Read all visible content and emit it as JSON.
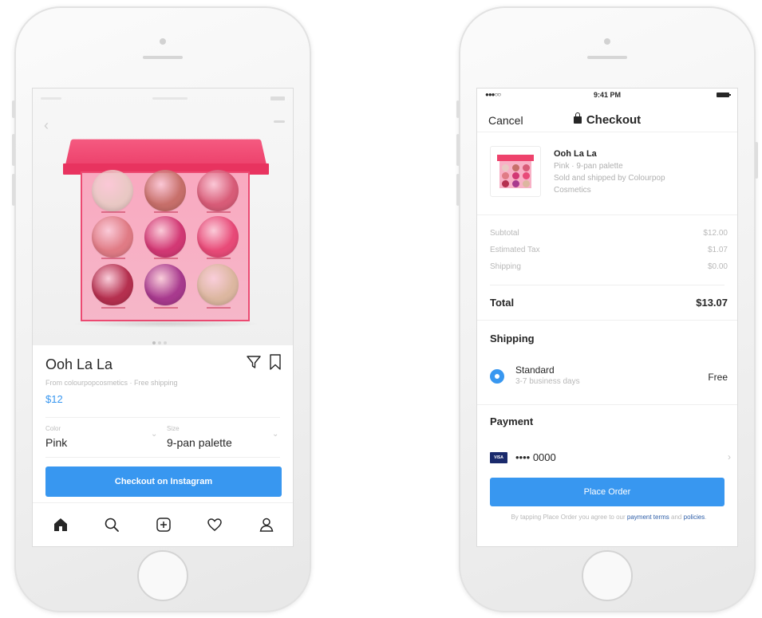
{
  "left_phone": {
    "product_name": "Ooh La La",
    "merchant_line": "From colourpopcosmetics · Free shipping",
    "price": "$12",
    "color_label": "Color",
    "color_value": "Pink",
    "size_label": "Size",
    "size_value": "9-pan palette",
    "checkout_button": "Checkout on Instagram",
    "icons": [
      "back-chevron",
      "more-dots",
      "filter-icon",
      "bookmark-icon",
      "home-icon",
      "search-icon",
      "add-icon",
      "heart-icon",
      "profile-icon"
    ],
    "palette_shade_colors": [
      "#e9c8c4",
      "#c76f6a",
      "#d85c78",
      "#e07b85",
      "#d23874",
      "#e84a78",
      "#b5304f",
      "#a83a8e",
      "#dcb7a0"
    ],
    "accent_color": "#3897f0"
  },
  "right_phone": {
    "status_time": "9:41 PM",
    "signal_text": "●●●○○",
    "cancel_label": "Cancel",
    "title": "Checkout",
    "item_title": "Ooh La La",
    "item_variant": "Pink · 9-pan palette",
    "item_seller_1": "Sold and shipped by Colourpop",
    "item_seller_2": "Cosmetics",
    "summary": [
      {
        "label": "Subtotal",
        "value": "$12.00"
      },
      {
        "label": "Estimated Tax",
        "value": "$1.07"
      },
      {
        "label": "Shipping",
        "value": "$0.00"
      }
    ],
    "total_label": "Total",
    "total_value": "$13.07",
    "shipping_heading": "Shipping",
    "shipping_option_name": "Standard",
    "shipping_option_days": "3-7 business days",
    "shipping_option_price": "Free",
    "payment_heading": "Payment",
    "card_brand": "VISA",
    "card_number": "•••• 0000",
    "place_order_button": "Place Order",
    "terms_prefix": "By tapping Place Order you agree to our",
    "terms_link_1": "payment terms",
    "terms_and": "and",
    "terms_link_2": "policies",
    "terms_suffix": ".",
    "accent_color": "#3897f0"
  }
}
